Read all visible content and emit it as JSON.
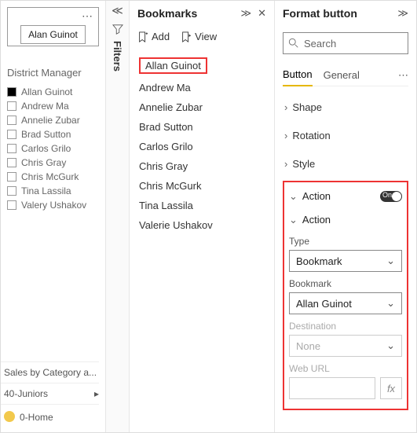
{
  "left": {
    "button_label": "Alan Guinot",
    "visual_menu": "⋯",
    "dm_title": "District Manager",
    "managers": [
      {
        "label": "Allan Guinot",
        "checked": true
      },
      {
        "label": "Andrew Ma",
        "checked": false
      },
      {
        "label": "Annelie Zubar",
        "checked": false
      },
      {
        "label": "Brad Sutton",
        "checked": false
      },
      {
        "label": "Carlos Grilo",
        "checked": false
      },
      {
        "label": "Chris Gray",
        "checked": false
      },
      {
        "label": "Chris McGurk",
        "checked": false
      },
      {
        "label": "Tina Lassila",
        "checked": false
      },
      {
        "label": "Valery Ushakov",
        "checked": false
      }
    ],
    "bottom1": "Sales by Category a...",
    "bottom2": "40-Juniors",
    "bottom3": "0-Home"
  },
  "filters": {
    "label": "Filters"
  },
  "bookmarks": {
    "title": "Bookmarks",
    "add": "Add",
    "view": "View",
    "items": [
      "Allan Guinot",
      "Andrew Ma",
      "Annelie Zubar",
      "Brad Sutton",
      "Carlos Grilo",
      "Chris Gray",
      "Chris McGurk",
      "Tina Lassila",
      "Valerie Ushakov"
    ]
  },
  "format": {
    "title": "Format button",
    "search_placeholder": "Search",
    "tabs": {
      "button": "Button",
      "general": "General"
    },
    "sections": {
      "shape": "Shape",
      "rotation": "Rotation",
      "style": "Style"
    },
    "action": {
      "header": "Action",
      "toggle_on": "On",
      "sub": "Action",
      "type_label": "Type",
      "type_value": "Bookmark",
      "bookmark_label": "Bookmark",
      "bookmark_value": "Allan Guinot",
      "destination_label": "Destination",
      "destination_value": "None",
      "weburl_label": "Web URL"
    }
  }
}
